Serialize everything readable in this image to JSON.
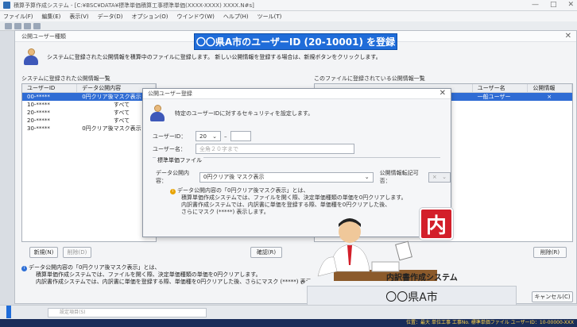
{
  "app": {
    "title": "積算予算作成システム - [C:¥BSC¥DATA¥標準単価積算工事標準単価(XXXX-XXXX) XXXX.N#s]",
    "menu": [
      "ファイル(F)",
      "編集(E)",
      "表示(V)",
      "データ(D)",
      "オプション(O)",
      "ウインドウ(W)",
      "ヘルプ(H)",
      "ツール(T)"
    ],
    "window_controls": [
      "—",
      "□",
      "✕"
    ]
  },
  "banner": {
    "text": "〇〇県A市のユーザーID (20-10001) を登録"
  },
  "main_dialog": {
    "title": "公開ユーザー種類",
    "intro": "システムに登録された公開情報を積算中のファイルに登録します。 新しい公開情報を登録する場合は、新規ボタンをクリックします。",
    "left_label": "システムに登録された公開情報一覧",
    "right_label": "このファイルに登録されている公開情報一覧",
    "left_grid": {
      "headers": [
        "ユーザーID",
        "データ公開内容"
      ],
      "rows": [
        {
          "id": "00-*****",
          "content": "0円クリア後マスク表示",
          "selected": true
        },
        {
          "id": "10-*****",
          "content": "すべて"
        },
        {
          "id": "20-*****",
          "content": "すべて"
        },
        {
          "id": "20-*****",
          "content": "すべて"
        },
        {
          "id": "30-*****",
          "content": "0円クリア後マスク表示"
        }
      ]
    },
    "right_grid": {
      "headers": [
        "ユーザー名",
        "公開情報"
      ],
      "rows": [
        {
          "name": "一般ユーザー",
          "info": "×",
          "selected": true
        }
      ]
    },
    "buttons": {
      "new": "新規(N)",
      "delete": "削除(D)",
      "select": "確認(R)",
      "remove": "削除(R)",
      "cancel": "キャンセル(C)"
    },
    "note": [
      "データ公開内容の「0円クリア後マスク表示」とは、",
      "積算単価作成システムでは、ファイルを開く際、決定単価種類の単価を0円クリアします。",
      "内訳書作成システムでは、内訳書に単価を登録する際、単価種を0円クリアした後、さらにマスク (*****) 表示します。"
    ]
  },
  "inner_dialog": {
    "title": "公開ユーザー登録",
    "intro": "特定のユーザーIDに対するセキュリティを設定します。",
    "user_id_label": "ユーザーID：",
    "user_id_prefix": "20",
    "user_id_sep": "–",
    "user_name_label": "ユーザー名：",
    "user_name_placeholder": "全角２０字まで",
    "section": "標準単価ファイル",
    "content_label": "データ公開内容：",
    "content_value": "0円クリア後 マスク表示",
    "public_label": "公開情報転記可否：",
    "public_value": "×",
    "note": [
      "データ公開内容の「0円クリア後マスク表示」とは、",
      "積算単価作成システムでは、ファイルを開く際、決定単価種類の単価を0円クリアします。",
      "内訳書作成システムでは、内訳書に単価を登録する際、単価種を0円クリアした後、",
      "さらにマスク (*****) 表示します。"
    ]
  },
  "overlay": {
    "logo_char": "内",
    "system_label": "内訳書作成システム",
    "city": "〇〇県A市"
  },
  "status": {
    "search_placeholder": "設定項目(S)",
    "bottom": "位置：最大  単位工事  工事No.  標準単価ファイル  ユーザーID：10-00000-XXX"
  },
  "colors": {
    "accent": "#1f6cd9",
    "selection": "#2f6cd4",
    "logo_red": "#d31f2a"
  }
}
